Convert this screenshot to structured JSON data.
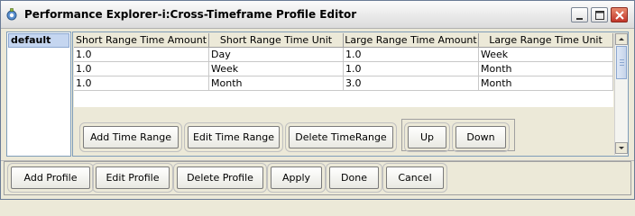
{
  "window": {
    "title": "Performance Explorer-i:Cross-Timeframe Profile Editor"
  },
  "profiles": {
    "items": [
      "default"
    ],
    "selected": "default"
  },
  "table": {
    "columns": [
      "Short Range Time Amount",
      "Short Range Time Unit",
      "Large Range Time Amount",
      "Large Range Time Unit"
    ],
    "rows": [
      [
        "1.0",
        "Day",
        "1.0",
        "Week"
      ],
      [
        "1.0",
        "Week",
        "1.0",
        "Month"
      ],
      [
        "1.0",
        "Month",
        "3.0",
        "Month"
      ]
    ]
  },
  "time_range_buttons": {
    "add": "Add Time Range",
    "edit": "Edit Time Range",
    "delete": "Delete TimeRange",
    "up": "Up",
    "down": "Down"
  },
  "bottom_buttons": {
    "add_profile": "Add Profile",
    "edit_profile": "Edit Profile",
    "delete_profile": "Delete Profile",
    "apply": "Apply",
    "done": "Done",
    "cancel": "Cancel"
  }
}
